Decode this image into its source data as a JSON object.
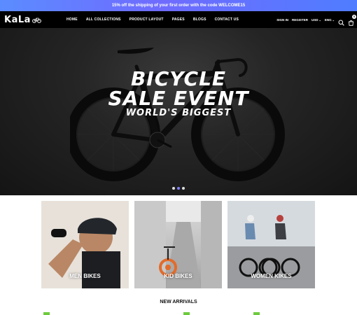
{
  "promo": {
    "text": "15% off the shipping of your first order with the code WELCOME15"
  },
  "header": {
    "logo": "KaLa",
    "nav": [
      "HOME",
      "ALL COLLECTIONS",
      "PRODUCT LAYOUT",
      "PAGES",
      "BLOGS",
      "CONTACT US"
    ],
    "sign_in": "SIGN IN",
    "register": "REGISTER",
    "currency": "USD",
    "language": "ENG",
    "cart_count": "0"
  },
  "hero": {
    "line1": "BICYCLE",
    "line2": "SALE EVENT",
    "line3": "WORLD'S BIGGEST",
    "slides": 3,
    "active_slide": 1
  },
  "collections": [
    {
      "label": "MEN BIKES"
    },
    {
      "label": "KID BIKES"
    },
    {
      "label": "WOMEN KIKES"
    }
  ],
  "section": {
    "title": "NEW ARRIVALS"
  },
  "colors": {
    "accent": "#6f6bff",
    "tag_green": "#6ccb3c"
  }
}
